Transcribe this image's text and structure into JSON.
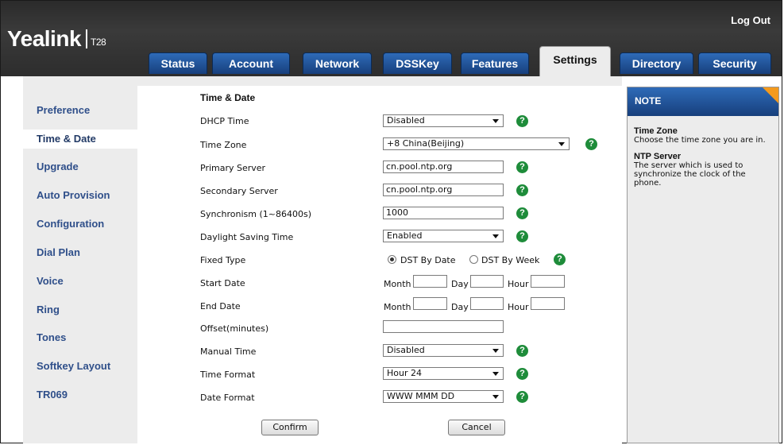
{
  "header": {
    "logo": "Yealink",
    "model": "T28",
    "logout": "Log Out"
  },
  "tabs": [
    {
      "label": "Status"
    },
    {
      "label": "Account"
    },
    {
      "label": "Network"
    },
    {
      "label": "DSSKey"
    },
    {
      "label": "Features"
    },
    {
      "label": "Settings"
    },
    {
      "label": "Directory"
    },
    {
      "label": "Security"
    }
  ],
  "sidebar": {
    "items": [
      {
        "label": "Preference"
      },
      {
        "label": "Time & Date"
      },
      {
        "label": "Upgrade"
      },
      {
        "label": "Auto Provision"
      },
      {
        "label": "Configuration"
      },
      {
        "label": "Dial Plan"
      },
      {
        "label": "Voice"
      },
      {
        "label": "Ring"
      },
      {
        "label": "Tones"
      },
      {
        "label": "Softkey Layout"
      },
      {
        "label": "TR069"
      }
    ]
  },
  "form": {
    "title": "Time & Date",
    "dhcp_time": {
      "label": "DHCP Time",
      "value": "Disabled"
    },
    "time_zone": {
      "label": "Time Zone",
      "value": "+8 China(Beijing)"
    },
    "primary_server": {
      "label": "Primary Server",
      "value": "cn.pool.ntp.org"
    },
    "secondary_server": {
      "label": "Secondary Server",
      "value": "cn.pool.ntp.org"
    },
    "synchronism": {
      "label": "Synchronism (1~86400s)",
      "value": "1000"
    },
    "daylight_saving": {
      "label": "Daylight Saving Time",
      "value": "Enabled"
    },
    "fixed_type": {
      "label": "Fixed Type",
      "option_date": "DST By Date",
      "option_week": "DST By Week"
    },
    "start_date": {
      "label": "Start Date"
    },
    "end_date": {
      "label": "End Date"
    },
    "date_parts": {
      "month": "Month",
      "day": "Day",
      "hour": "Hour"
    },
    "offset": {
      "label": "Offset(minutes)",
      "value": ""
    },
    "manual_time": {
      "label": "Manual Time",
      "value": "Disabled"
    },
    "time_format": {
      "label": "Time Format",
      "value": "Hour 24"
    },
    "date_format": {
      "label": "Date Format",
      "value": "WWW MMM DD"
    },
    "help_glyph": "?",
    "confirm": "Confirm",
    "cancel": "Cancel"
  },
  "note": {
    "title": "NOTE",
    "time_zone_title": "Time Zone",
    "time_zone_text": "Choose the time zone you are in.",
    "ntp_title": "NTP Server",
    "ntp_text": "The server which is used to synchronize the clock of the phone."
  },
  "colors": {
    "header_dark": "#2d2d2d",
    "tab_blue": "#1f4f95",
    "panel_gray": "#ececec",
    "sidebar_text": "#2f4f8a",
    "help_green": "#1e8c3a",
    "note_accent": "#f39a1e"
  }
}
